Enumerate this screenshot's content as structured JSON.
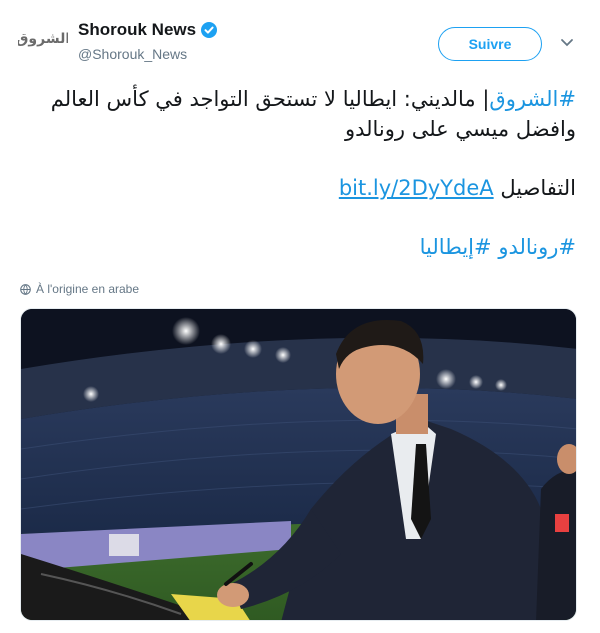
{
  "account": {
    "display_name": "Shorouk News",
    "handle": "@Shorouk_News",
    "logo_text": "الشروق",
    "verified": true
  },
  "actions": {
    "follow_label": "Suivre",
    "more_icon": "chevron-down-icon"
  },
  "tweet": {
    "hashtag_source": "#الشروق",
    "headline": "| مالديني: ايطاليا لا تستحق التواجد في كأس العالم",
    "headline_line2": "وافضل ميسي على رونالدو",
    "details_label": "التفاصيل",
    "link_text": "bit.ly/2DyYdeA",
    "hashtag_1": "#رونالدو",
    "hashtag_2": "#إيطاليا"
  },
  "translation": {
    "label": "À l'origine en arabe",
    "icon": "globe-icon"
  },
  "colors": {
    "accent": "#1da1f2",
    "link": "#1b95e0",
    "secondary_text": "#657786"
  }
}
